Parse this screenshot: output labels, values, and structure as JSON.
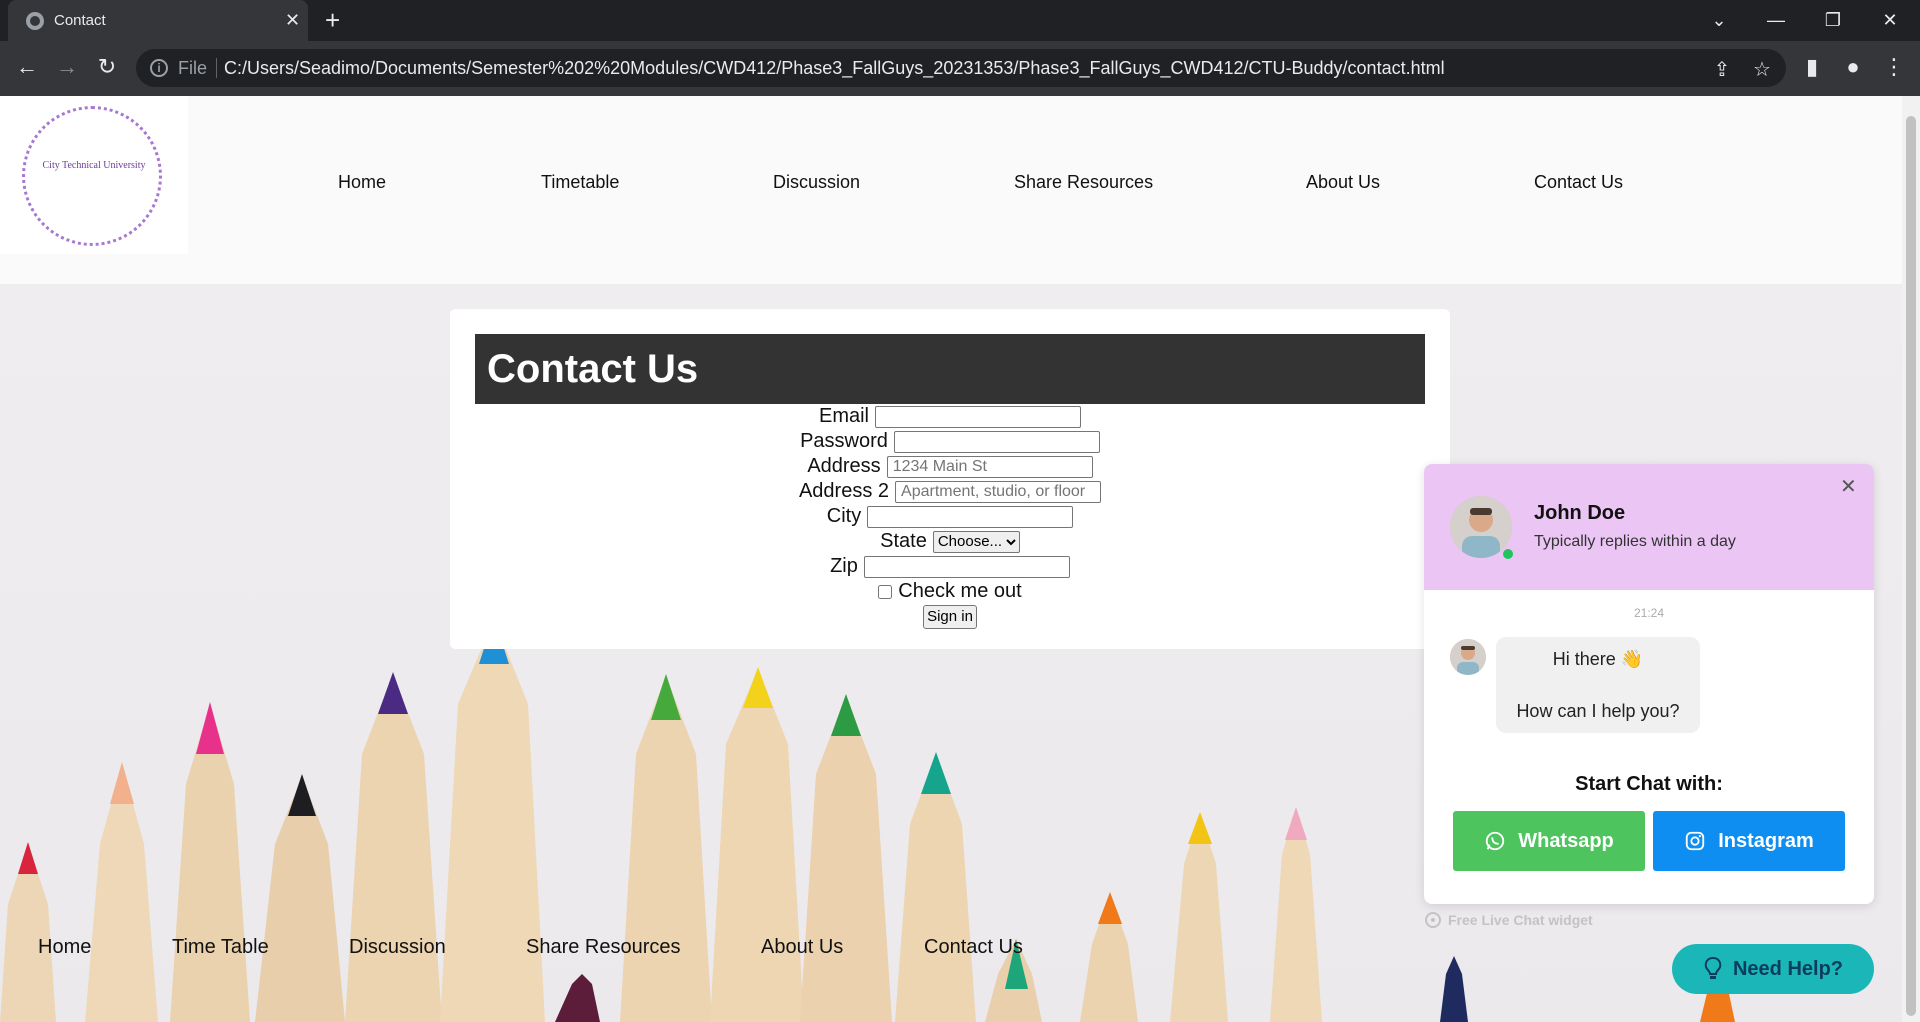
{
  "browser": {
    "tab_title": "Contact",
    "tab_close": "✕",
    "new_tab": "+",
    "omnibox_scheme": "File",
    "url": "C:/Users/Seadimo/Documents/Semester%202%20Modules/CWD412/Phase3_FallGuys_20231353/Phase3_FallGuys_CWD412/CTU-Buddy/contact.html",
    "window_buttons": {
      "dropdown": "⌄",
      "minimize": "—",
      "restore": "❐",
      "close": "✕"
    },
    "toolbar_icons": {
      "back": "←",
      "forward": "→",
      "reload": "↻",
      "share": "⇪",
      "star": "☆",
      "sidepanel": "▮",
      "profile": "●",
      "menu": "⋮"
    }
  },
  "site": {
    "logo_text": "City Technical University",
    "nav": [
      "Home",
      "Timetable",
      "Discussion",
      "Share Resources",
      "About Us",
      "Contact Us"
    ],
    "footer_nav": [
      "Home",
      "Time Table",
      "Discussion",
      "Share Resources",
      "About Us",
      "Contact Us"
    ]
  },
  "contact_form": {
    "title": "Contact Us",
    "email_label": "Email",
    "password_label": "Password",
    "address_label": "Address",
    "address_placeholder": "1234 Main St",
    "address2_label": "Address 2",
    "address2_placeholder": "Apartment, studio, or floor",
    "city_label": "City",
    "state_label": "State",
    "state_selected": "Choose...",
    "zip_label": "Zip",
    "checkbox_label": "Check me out",
    "submit_label": "Sign in"
  },
  "chat_widget": {
    "close": "✕",
    "agent_name": "John Doe",
    "agent_status": "Typically replies within a day",
    "time": "21:24",
    "message_line1": "Hi there 👋",
    "message_line2": "How can I help you?",
    "start_label": "Start Chat with:",
    "whatsapp_label": "Whatsapp",
    "instagram_label": "Instagram",
    "free_widget": "Free Live Chat widget",
    "need_help": "Need Help?",
    "colors": {
      "header": "#ebc6f5",
      "whatsapp": "#4dc45d",
      "instagram": "#0d8ef0",
      "need_help": "#1ab6b8",
      "online": "#1ec55a"
    },
    "icons": [
      "whatsapp-icon",
      "instagram-icon",
      "lightbulb-icon",
      "refresh-icon"
    ]
  }
}
